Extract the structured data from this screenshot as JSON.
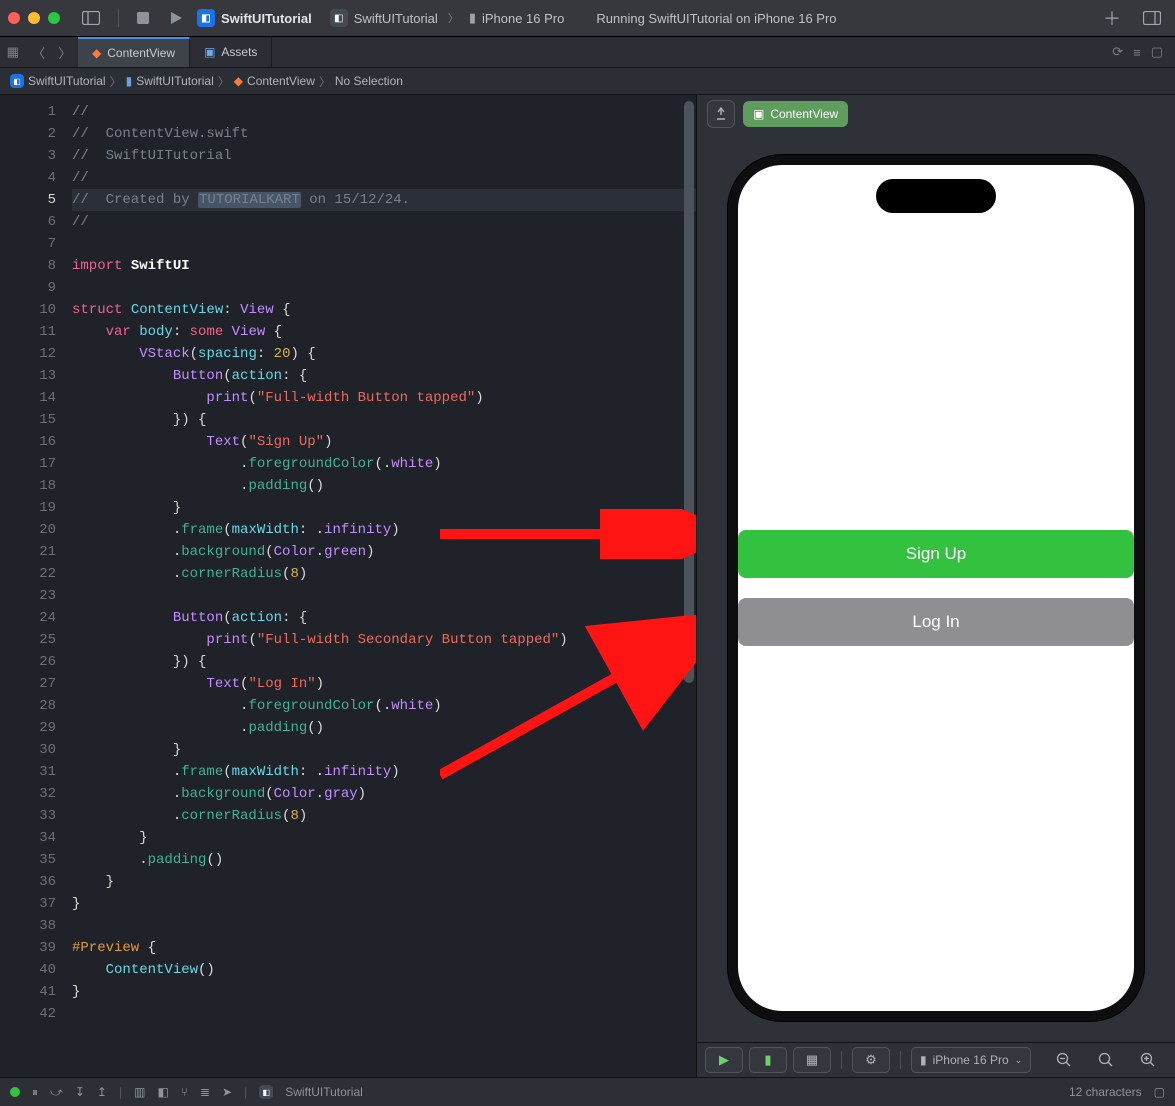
{
  "titlebar": {
    "project": "SwiftUITutorial",
    "scheme_app": "SwiftUITutorial",
    "scheme_device": "iPhone 16 Pro",
    "status": "Running SwiftUITutorial on iPhone 16 Pro"
  },
  "tabs": {
    "active": "ContentView",
    "other": "Assets"
  },
  "crumbs": {
    "c1": "SwiftUITutorial",
    "c2": "SwiftUITutorial",
    "c3": "ContentView",
    "c4": "No Selection"
  },
  "gutter": [
    "1",
    "2",
    "3",
    "4",
    "5",
    "6",
    "7",
    "8",
    "9",
    "10",
    "11",
    "12",
    "13",
    "14",
    "15",
    "16",
    "17",
    "18",
    "19",
    "20",
    "21",
    "22",
    "23",
    "24",
    "25",
    "26",
    "27",
    "28",
    "29",
    "30",
    "31",
    "32",
    "33",
    "34",
    "35",
    "36",
    "37",
    "38",
    "39",
    "40",
    "41",
    "42"
  ],
  "code": {
    "l1": "//",
    "l2_a": "//  ",
    "l2_b": "ContentView.swift",
    "l3_a": "//  ",
    "l3_b": "SwiftUITutorial",
    "l4": "//",
    "l5_a": "//  ",
    "l5_b": "Created by ",
    "l5_sel": "TUTORIALKART",
    "l5_c": " on 15/12/24.",
    "l6": "//",
    "l7": "",
    "l8_a": "import",
    "l8_b": " SwiftUI",
    "l9": "",
    "l10_a": "struct",
    "l10_b": " ContentView",
    "l10_c": ": ",
    "l10_d": "View",
    "l10_e": " {",
    "l11_a": "    ",
    "l11_b": "var",
    "l11_c": " body",
    "l11_d": ": ",
    "l11_e": "some",
    "l11_f": " View",
    "l11_g": " {",
    "l12_a": "        ",
    "l12_b": "VStack",
    "l12_c": "(",
    "l12_d": "spacing",
    "l12_e": ": ",
    "l12_f": "20",
    "l12_g": ") {",
    "l13_a": "            ",
    "l13_b": "Button",
    "l13_c": "(",
    "l13_d": "action",
    "l13_e": ": {",
    "l14_a": "                ",
    "l14_b": "print",
    "l14_c": "(",
    "l14_d": "\"Full-width Button tapped\"",
    "l14_e": ")",
    "l15": "            }) {",
    "l16_a": "                ",
    "l16_b": "Text",
    "l16_c": "(",
    "l16_d": "\"Sign Up\"",
    "l16_e": ")",
    "l17_a": "                    .",
    "l17_b": "foregroundColor",
    "l17_c": "(.",
    "l17_d": "white",
    "l17_e": ")",
    "l18_a": "                    .",
    "l18_b": "padding",
    "l18_c": "()",
    "l19": "            }",
    "l20_a": "            .",
    "l20_b": "frame",
    "l20_c": "(",
    "l20_d": "maxWidth",
    "l20_e": ": .",
    "l20_f": "infinity",
    "l20_g": ")",
    "l21_a": "            .",
    "l21_b": "background",
    "l21_c": "(",
    "l21_d": "Color",
    "l21_e": ".",
    "l21_f": "green",
    "l21_g": ")",
    "l22_a": "            .",
    "l22_b": "cornerRadius",
    "l22_c": "(",
    "l22_d": "8",
    "l22_e": ")",
    "l23": "",
    "l24_a": "            ",
    "l24_b": "Button",
    "l24_c": "(",
    "l24_d": "action",
    "l24_e": ": {",
    "l25_a": "                ",
    "l25_b": "print",
    "l25_c": "(",
    "l25_d": "\"Full-width Secondary Button tapped\"",
    "l25_e": ")",
    "l26": "            }) {",
    "l27_a": "                ",
    "l27_b": "Text",
    "l27_c": "(",
    "l27_d": "\"Log In\"",
    "l27_e": ")",
    "l28_a": "                    .",
    "l28_b": "foregroundColor",
    "l28_c": "(.",
    "l28_d": "white",
    "l28_e": ")",
    "l29_a": "                    .",
    "l29_b": "padding",
    "l29_c": "()",
    "l30": "            }",
    "l31_a": "            .",
    "l31_b": "frame",
    "l31_c": "(",
    "l31_d": "maxWidth",
    "l31_e": ": .",
    "l31_f": "infinity",
    "l31_g": ")",
    "l32_a": "            .",
    "l32_b": "background",
    "l32_c": "(",
    "l32_d": "Color",
    "l32_e": ".",
    "l32_f": "gray",
    "l32_g": ")",
    "l33_a": "            .",
    "l33_b": "cornerRadius",
    "l33_c": "(",
    "l33_d": "8",
    "l33_e": ")",
    "l34": "        }",
    "l35_a": "        .",
    "l35_b": "padding",
    "l35_c": "()",
    "l36": "    }",
    "l37": "}",
    "l38": "",
    "l39_a": "#Preview",
    "l39_b": " {",
    "l40_a": "    ",
    "l40_b": "ContentView",
    "l40_c": "()",
    "l41": "}",
    "l42": ""
  },
  "preview": {
    "chip": "ContentView",
    "signup": "Sign Up",
    "login": "Log In",
    "device": "iPhone 16 Pro"
  },
  "status": {
    "project": "SwiftUITutorial",
    "chars": "12 characters"
  }
}
